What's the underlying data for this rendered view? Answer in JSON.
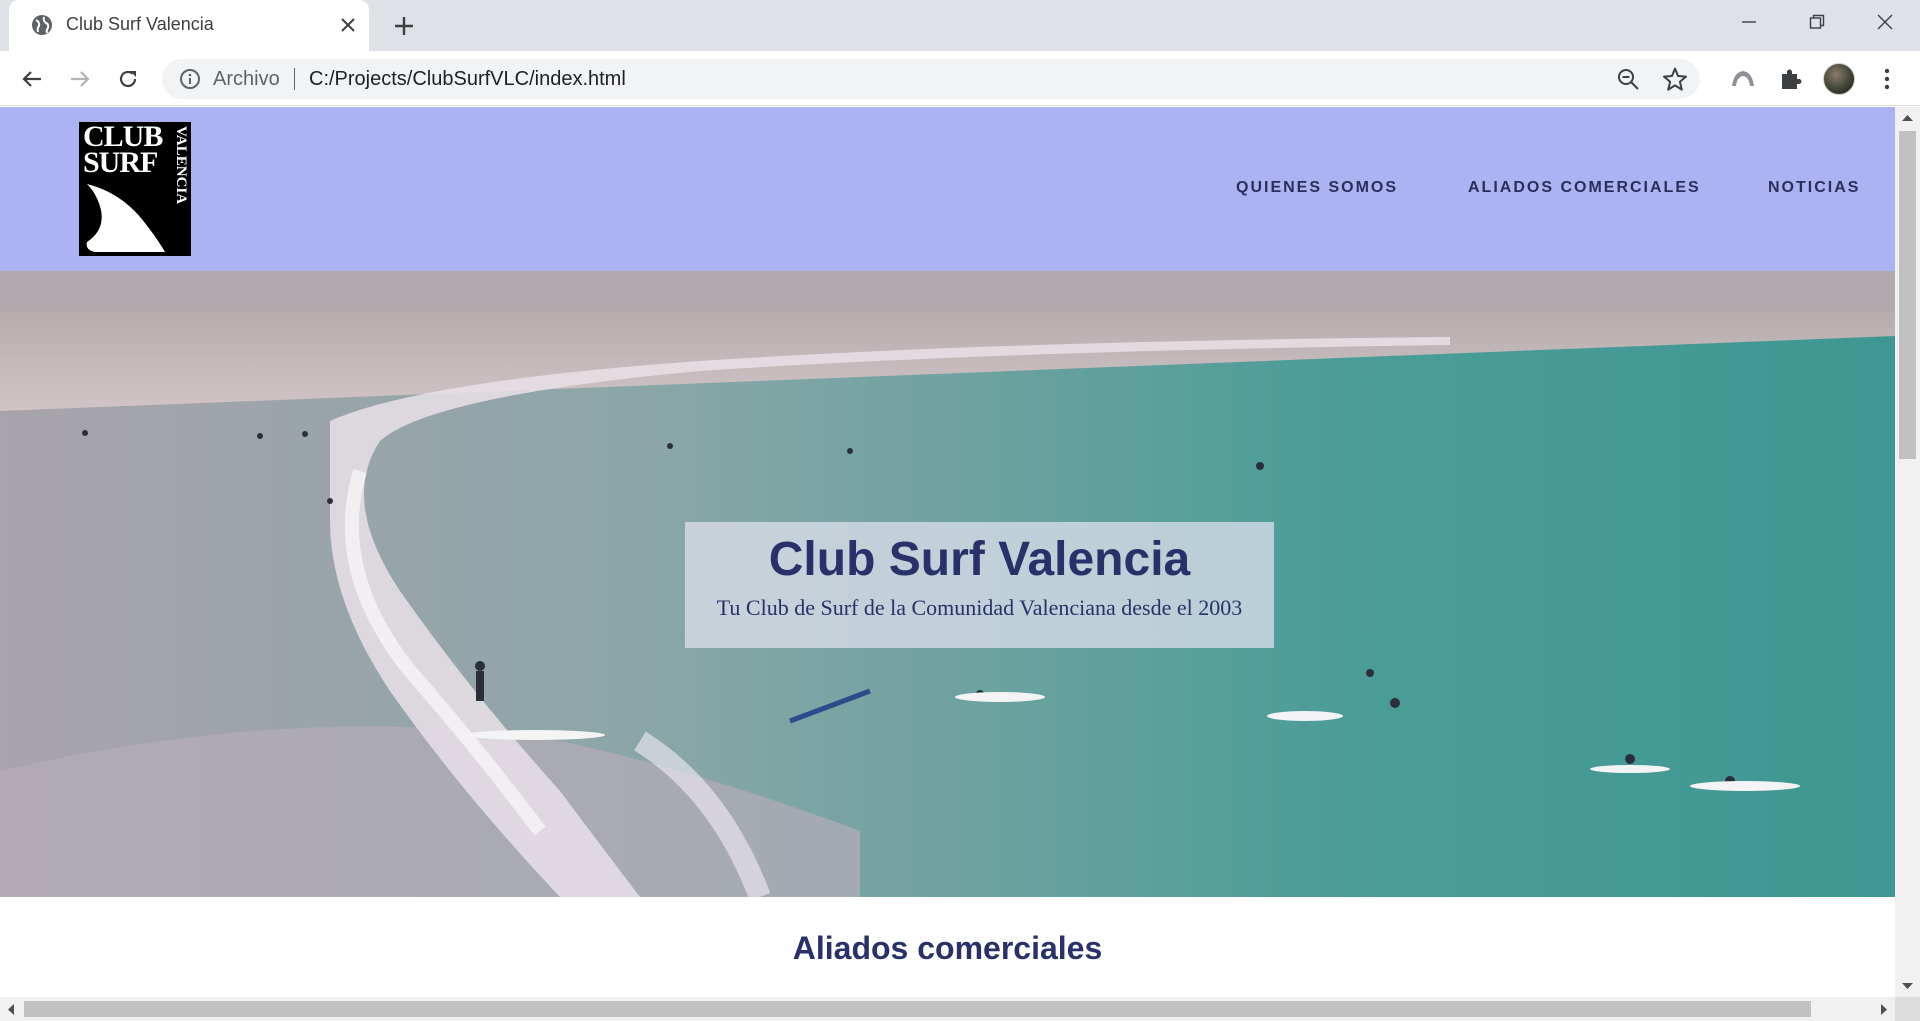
{
  "browser": {
    "tab_title": "Club Surf Valencia",
    "omnibox_label": "Archivo",
    "url": "C:/Projects/ClubSurfVLC/index.html"
  },
  "site": {
    "logo": {
      "line1": "CLUB",
      "line2": "SURF",
      "line3": "VALENCIA"
    },
    "nav": [
      "QUIENES SOMOS",
      "ALIADOS COMERCIALES",
      "NOTICIAS"
    ],
    "hero_title": "Club Surf Valencia",
    "hero_subtitle": "Tu Club de Surf de la Comunidad Valenciana desde el 2003",
    "section_title": "Aliados comerciales"
  },
  "colors": {
    "header_bg": "#abb3f3",
    "brand_text": "#28316a",
    "nav_text": "#2a2f5a"
  },
  "icons": [
    "globe-icon",
    "close-icon",
    "plus-icon",
    "minimize-icon",
    "restore-icon",
    "back-icon",
    "forward-icon",
    "reload-icon",
    "info-icon",
    "zoom-out-icon",
    "star-icon",
    "extension-shield-icon",
    "puzzle-icon",
    "menu-dots-icon"
  ]
}
